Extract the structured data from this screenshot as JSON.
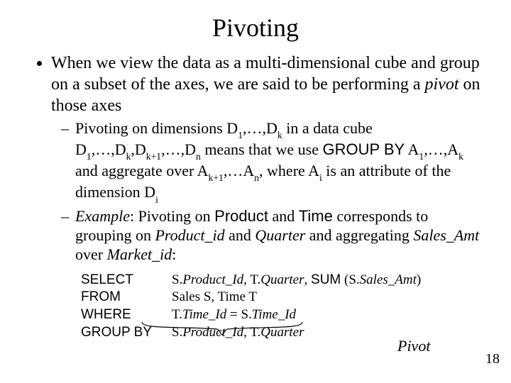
{
  "title": "Pivoting",
  "bullet1": {
    "pre": "When we view the data as a multi-dimensional cube and group on a subset of the axes, we are said to be performing a ",
    "pivot_word": "pivot",
    "post": " on those axes"
  },
  "sub1": {
    "a": "Pivoting on dimensions D",
    "b": ",…,D",
    "c": " in a data cube D",
    "d": ",…,D",
    "e": ",D",
    "f": ",…,D",
    "g": " means that we use ",
    "groupby": "GROUP BY",
    "h": " A",
    "i": ",…,A",
    "j": " and aggregate over A",
    "k": ",…A",
    "l": ", where A",
    "m": " is an attribute of the dimension D",
    "idx_1a": "1",
    "idx_k": "k",
    "idx_kp1": "k+1",
    "idx_n": "n",
    "idx_i": "i"
  },
  "sub2": {
    "example_word": "Example",
    "a": ": Pivoting on ",
    "prod": "Product",
    "b": " and ",
    "time": "Time",
    "c": " corresponds to grouping on ",
    "prodid": "Product_id",
    "d": " and ",
    "quarter": "Quarter",
    "e": " and aggregating ",
    "salesamt": "Sales_Amt",
    "f": " over ",
    "marketid": "Market_id",
    "g": ":"
  },
  "sql": {
    "select_kw": "SELECT",
    "select_rest_a": "S.",
    "select_prod": "Product_Id",
    "select_rest_b": ",  T.",
    "select_quarter": "Quarter",
    "select_rest_c": ",  ",
    "sum_kw": "SUM",
    "select_rest_d": " (S.",
    "select_sales": "Sales_Amt",
    "select_rest_e": ")",
    "from_kw": "FROM",
    "from_rest": "Sales S,  Time T",
    "where_kw": "WHERE",
    "where_rest_a": "T.",
    "where_tid1": "Time_Id",
    "where_rest_b": " = S.",
    "where_tid2": "Time_Id",
    "groupby_kw": "GROUP BY",
    "groupby_rest_a": "S.",
    "groupby_prod": "Product_Id",
    "groupby_rest_b": ",  T.",
    "groupby_quarter": "Quarter"
  },
  "brace_label": "Pivot",
  "pagenum": "18"
}
